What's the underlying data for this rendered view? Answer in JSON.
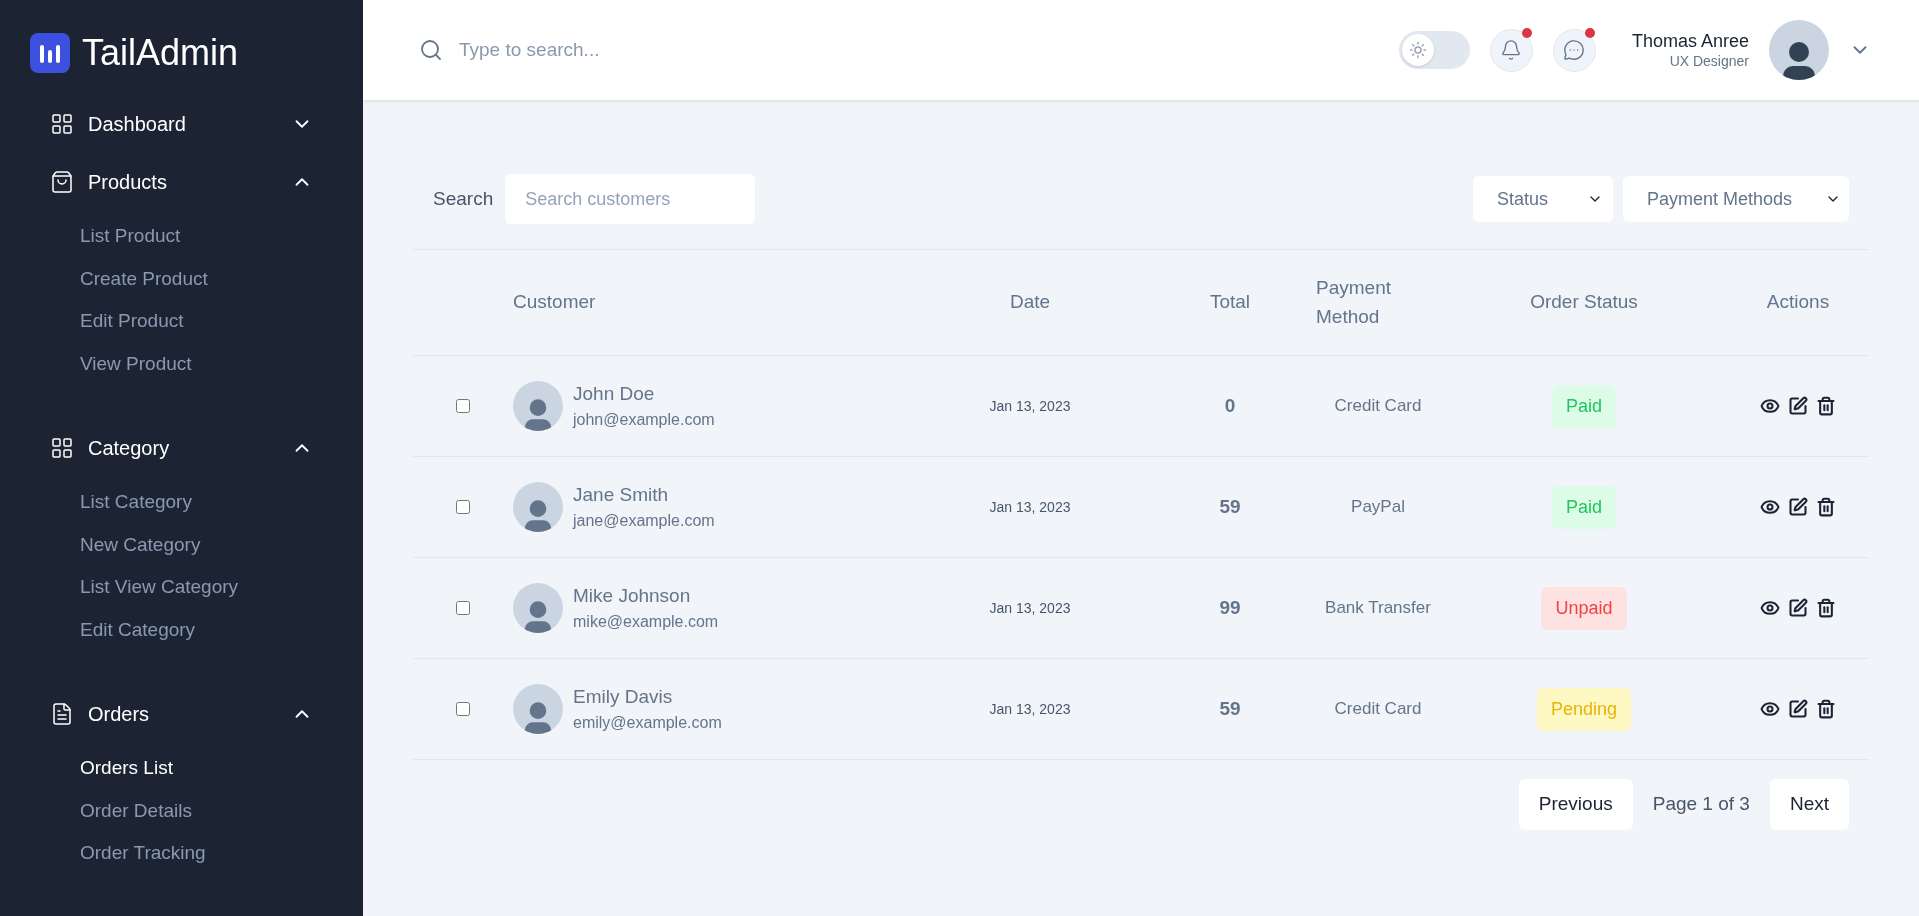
{
  "brand": {
    "name": "TailAdmin"
  },
  "sidebar": {
    "items": [
      {
        "label": "Dashboard",
        "expanded": false
      },
      {
        "label": "Products",
        "expanded": true,
        "children": [
          {
            "label": "List Product",
            "selected": false
          },
          {
            "label": "Create Product",
            "selected": false
          },
          {
            "label": "Edit Product",
            "selected": false
          },
          {
            "label": "View Product",
            "selected": false
          }
        ]
      },
      {
        "label": "Category",
        "expanded": true,
        "children": [
          {
            "label": "List Category",
            "selected": false
          },
          {
            "label": "New Category",
            "selected": false
          },
          {
            "label": "List View Category",
            "selected": false
          },
          {
            "label": "Edit Category",
            "selected": false
          }
        ]
      },
      {
        "label": "Orders",
        "expanded": true,
        "children": [
          {
            "label": "Orders List",
            "selected": true
          },
          {
            "label": "Order Details",
            "selected": false
          },
          {
            "label": "Order Tracking",
            "selected": false
          }
        ]
      }
    ]
  },
  "header": {
    "search": {
      "placeholder": "Type to search..."
    },
    "dark_mode": {
      "on": false
    },
    "notifications": {
      "unread": true
    },
    "messages": {
      "unread": true
    },
    "user": {
      "name": "Thomas Anree",
      "role": "UX Designer"
    }
  },
  "filters": {
    "search_label": "Search",
    "search": {
      "placeholder": "Search customers"
    },
    "status": {
      "value": "Status"
    },
    "payment": {
      "value": "Payment Methods"
    }
  },
  "table": {
    "columns": [
      "Customer",
      "Date",
      "Total",
      "Payment Method",
      "Order Status",
      "Actions"
    ],
    "rows": [
      {
        "checked": false,
        "name": "John Doe",
        "email": "john@example.com",
        "date": "Jan 13, 2023",
        "total": "0",
        "payment": "Credit Card",
        "status": {
          "label": "Paid",
          "kind": "paid"
        }
      },
      {
        "checked": false,
        "name": "Jane Smith",
        "email": "jane@example.com",
        "date": "Jan 13, 2023",
        "total": "59",
        "payment": "PayPal",
        "status": {
          "label": "Paid",
          "kind": "paid"
        }
      },
      {
        "checked": false,
        "name": "Mike Johnson",
        "email": "mike@example.com",
        "date": "Jan 13, 2023",
        "total": "99",
        "payment": "Bank Transfer",
        "status": {
          "label": "Unpaid",
          "kind": "unpaid"
        }
      },
      {
        "checked": false,
        "name": "Emily Davis",
        "email": "emily@example.com",
        "date": "Jan 13, 2023",
        "total": "59",
        "payment": "Credit Card",
        "status": {
          "label": "Pending",
          "kind": "pending"
        }
      }
    ]
  },
  "pagination": {
    "previous": "Previous",
    "page": "Page 1 of 3",
    "next": "Next"
  }
}
